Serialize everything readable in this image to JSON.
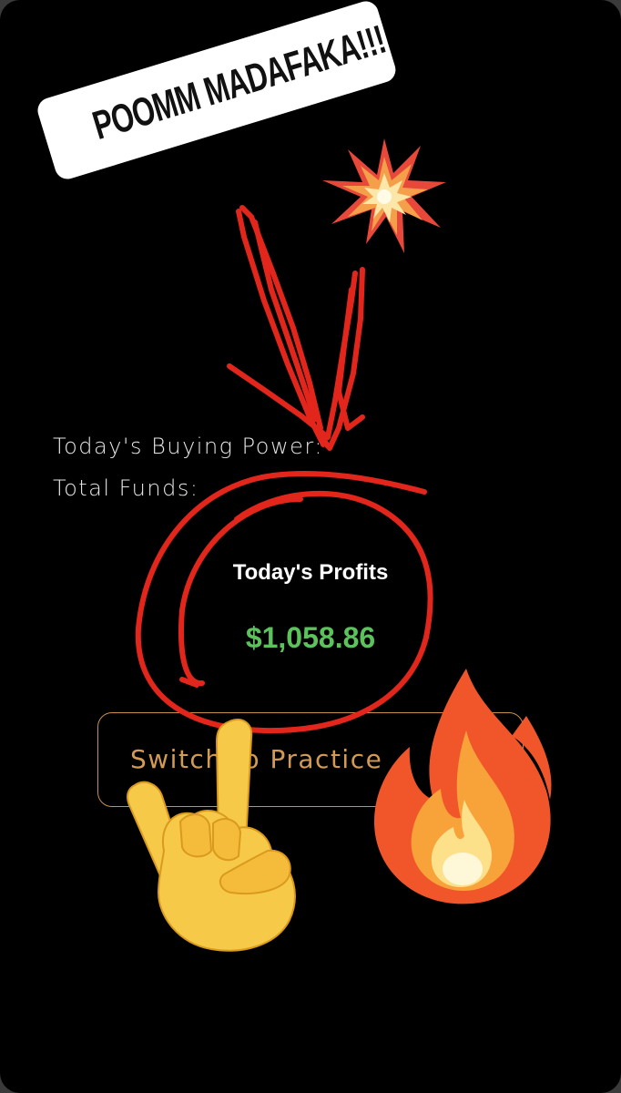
{
  "balances": {
    "buying_power_label": "Today's Buying Power:",
    "total_funds_label": "Total Funds:"
  },
  "profits": {
    "title": "Today's Profits",
    "value": "$1,058.86",
    "value_color": "#5cc25c"
  },
  "switch_button": {
    "label": "Switch to Practice",
    "border_color": "#c98f4e"
  },
  "sticker": {
    "text": "POOMM MADAFAKA!!!"
  },
  "annotations": {
    "stroke_color": "#e3261b",
    "emoji": [
      "collision-emoji",
      "sign-of-the-horns-emoji",
      "fire-emoji"
    ]
  }
}
